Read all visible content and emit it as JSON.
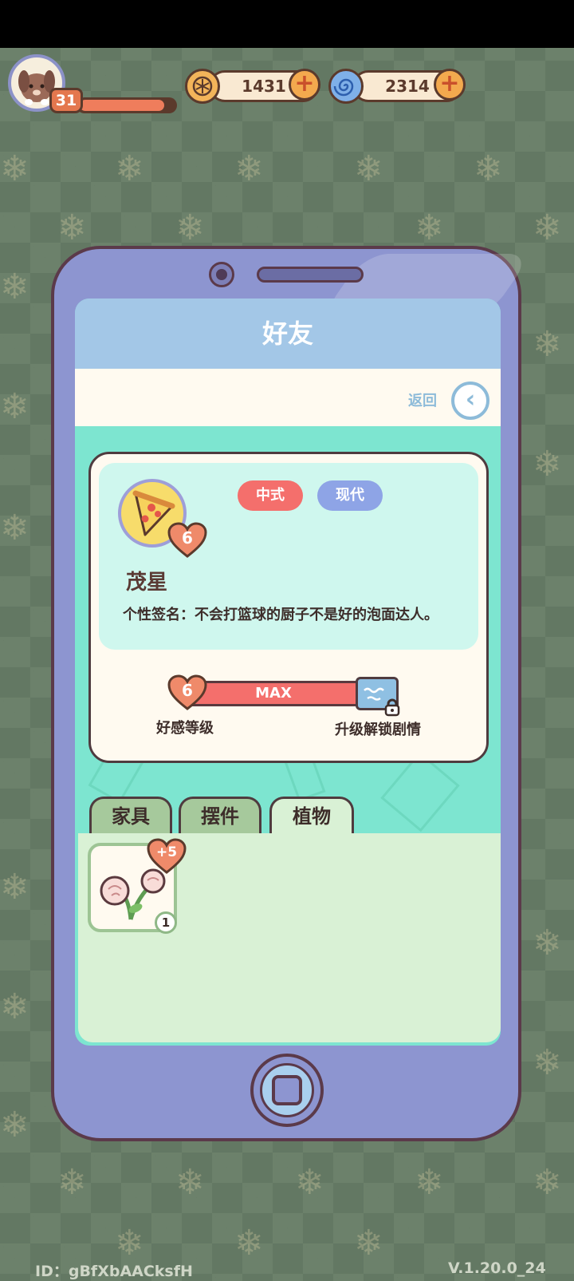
{
  "player": {
    "level": "31",
    "xp_fraction": 0.9
  },
  "currencies": [
    {
      "name": "coin",
      "value": "1431",
      "icon": "coin-icon",
      "color": "#f3b45a"
    },
    {
      "name": "gem",
      "value": "2314",
      "icon": "swirl-gem-icon",
      "color": "#7fb0e8"
    }
  ],
  "screen": {
    "title": "好友",
    "back_label": "返回"
  },
  "friend": {
    "name": "茂星",
    "affinity_level": "6",
    "tags": [
      {
        "label": "中式",
        "color": "#f46f6c"
      },
      {
        "label": "现代",
        "color": "#8ea4e6"
      }
    ],
    "signature": "个性签名：不会打篮球的厨子不是好的泡面达人。",
    "affinity_bar_text": "MAX",
    "affinity_label": "好感等级",
    "unlock_label": "升级解锁剧情"
  },
  "tabs": [
    {
      "label": "家具",
      "active": false
    },
    {
      "label": "摆件",
      "active": false
    },
    {
      "label": "植物",
      "active": true
    }
  ],
  "items": [
    {
      "name": "rose-plant",
      "bonus": "+5",
      "count": "1"
    }
  ],
  "footer": {
    "id": "ID：gBfXbAACksfH",
    "version": "V.1.20.0_24"
  }
}
